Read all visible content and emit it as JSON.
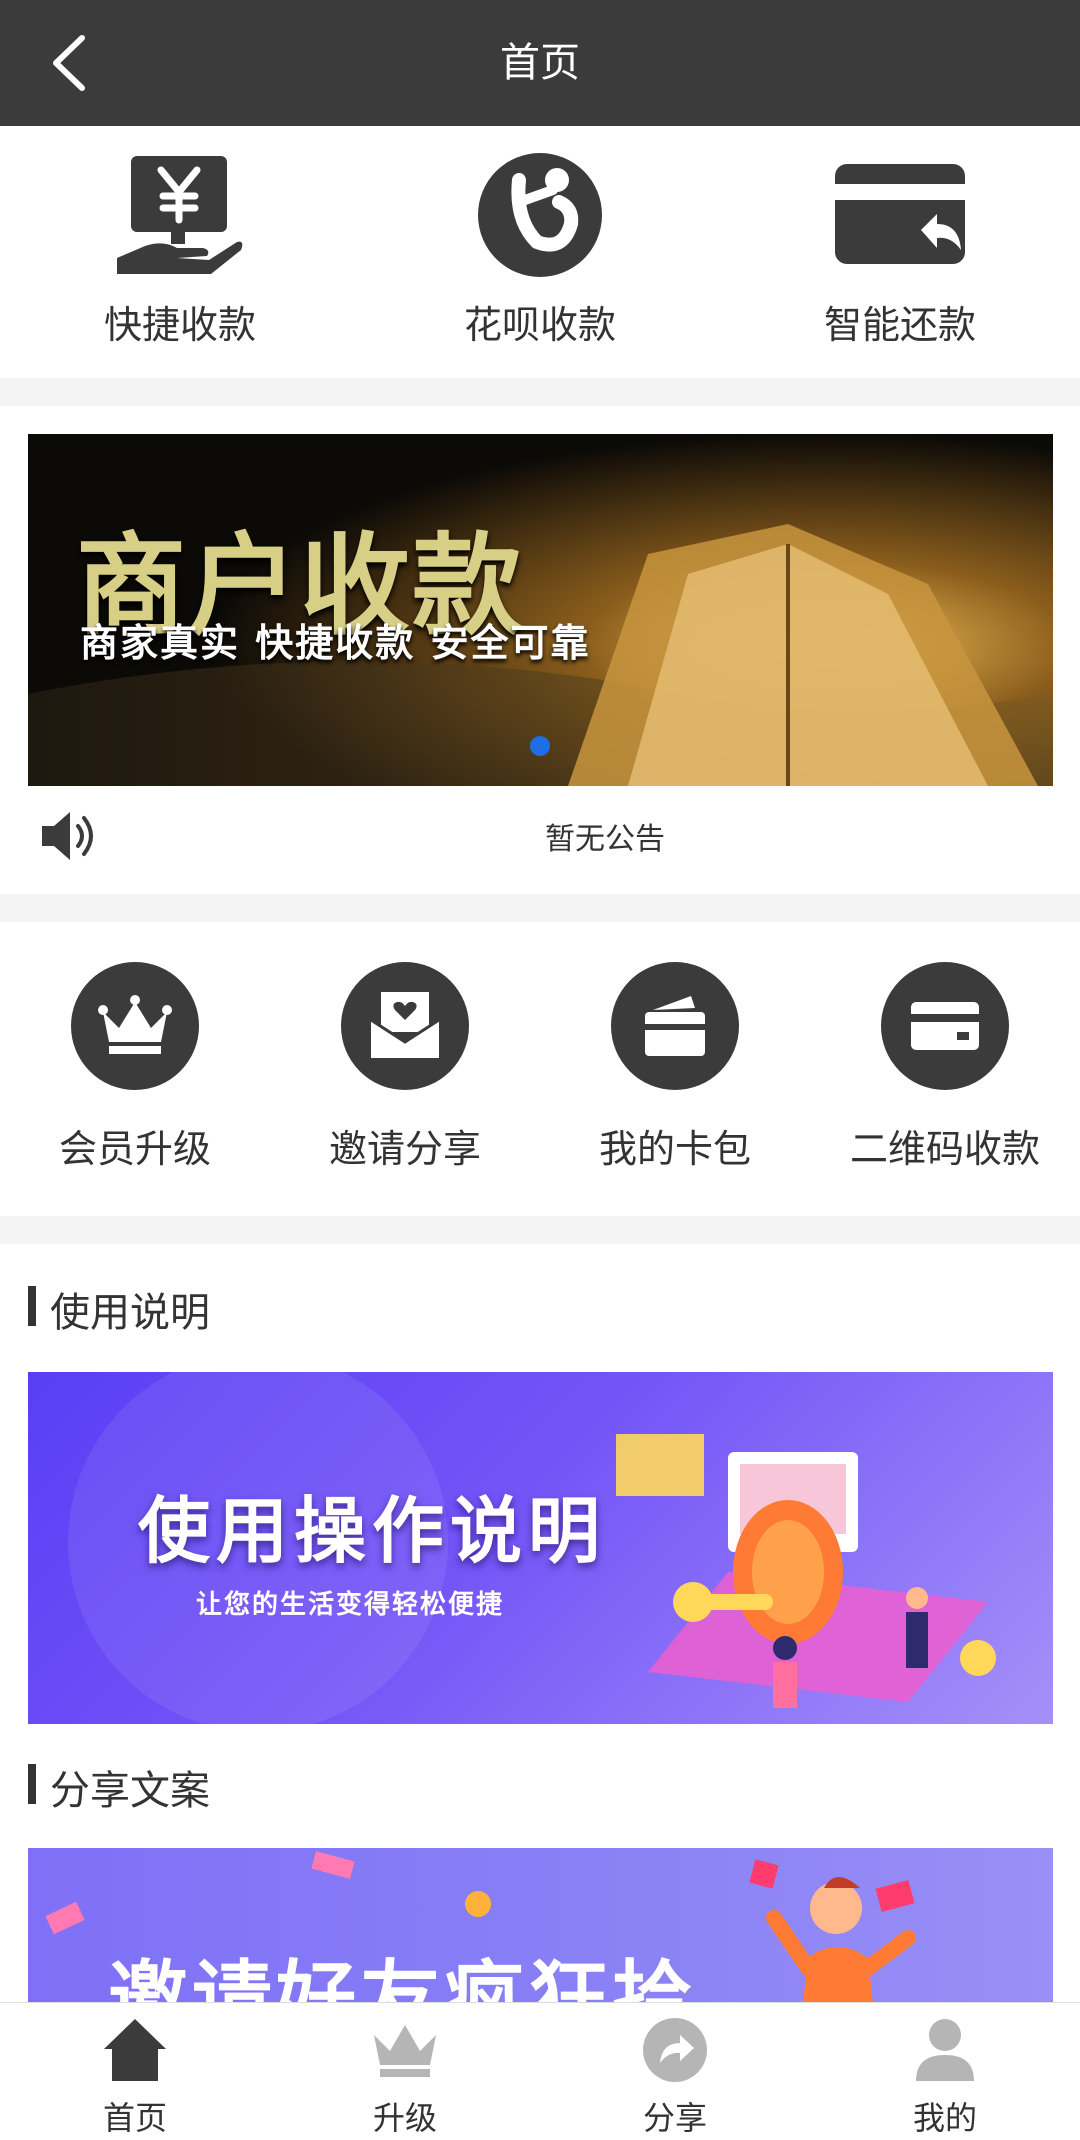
{
  "header": {
    "title": "首页",
    "back_icon": "chevron-left-icon"
  },
  "quick_actions": [
    {
      "label": "快捷收款",
      "icon": "yen-hand-icon"
    },
    {
      "label": "花呗收款",
      "icon": "huabei-logo-icon"
    },
    {
      "label": "智能还款",
      "icon": "card-return-icon"
    }
  ],
  "banner": {
    "headline": "商户收款",
    "subline": "商家真实 快捷收款 安全可靠",
    "active_dot_color": "#1e6ee6"
  },
  "notice": {
    "icon": "speaker-icon",
    "text": "暂无公告"
  },
  "menu": [
    {
      "label": "会员升级",
      "icon": "crown-icon"
    },
    {
      "label": "邀请分享",
      "icon": "heart-envelope-icon"
    },
    {
      "label": "我的卡包",
      "icon": "wallet-cards-icon"
    },
    {
      "label": "二维码收款",
      "icon": "card-icon"
    }
  ],
  "sections": {
    "guide_title": "使用说明",
    "guide_banner": {
      "headline": "使用操作说明",
      "subline": "让您的生活变得轻松便捷"
    },
    "share_title": "分享文案",
    "share_banner": {
      "headline": "邀请好友疯狂拾"
    }
  },
  "tabbar": [
    {
      "label": "首页",
      "icon": "home-icon",
      "active": true
    },
    {
      "label": "升级",
      "icon": "crown-icon",
      "active": false
    },
    {
      "label": "分享",
      "icon": "share-arrow-icon",
      "active": false
    },
    {
      "label": "我的",
      "icon": "user-icon",
      "active": false
    }
  ],
  "colors": {
    "header_bg": "#3b3b3b",
    "icon_dark": "#3b3b3b",
    "icon_inactive": "#b5b5b5",
    "page_bg": "#f4f4f4"
  }
}
